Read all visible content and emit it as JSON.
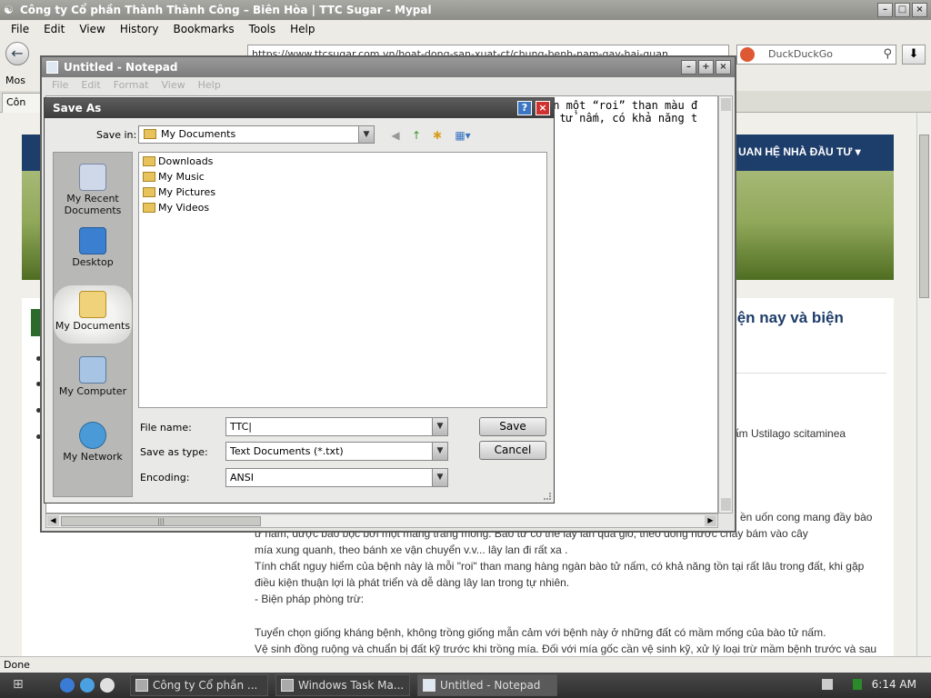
{
  "browser": {
    "title": "Công ty Cổ phần Thành Thành Công – Biên Hòa | TTC Sugar - Mypal",
    "menu": [
      "File",
      "Edit",
      "View",
      "History",
      "Bookmarks",
      "Tools",
      "Help"
    ],
    "site_identity": "ttcsugar.com.vn",
    "url": "https://www.ttcsugar.com.vn/hoat-dong-san-xuat-ct/chung-benh-nam-gay-hai-quan",
    "search_placeholder": "DuckDuckGo",
    "bookmarks_label": "Mos",
    "tab_label": "Côn",
    "status": "Done"
  },
  "page": {
    "nav_label": "UAN HỆ NHÀ ĐẦU TƯ ▾",
    "heading": "iện nay và biện",
    "side_line": "ấm Ustilago scitaminea",
    "text_lines": [
      "ền uốn cong mang đầy bào",
      "ư nấm, được bao bọc bởi một màng trắng mỏng. Bào tử có thể lây lan qua gió, theo dòng nước chảy bám vào cây",
      "mía xung quanh, theo bánh xe vận chuyển v.v... lây lan đi rất xa .",
      "Tính chất nguy hiểm của bệnh này là mỗi \"roi\" than mang hàng ngàn bào tử nấm, có khả năng tồn tại rất lâu trong đất, khi gặp",
      "điều kiện thuận lợi là phát triển và dễ dàng lây lan trong tự nhiên.",
      "- Biện pháp phòng trừ:",
      "  Tuyển chọn giống kháng bệnh, không trồng giống mẫn cảm với bệnh này ở những đất có mầm mống của bào tử nấm.",
      "Vệ sinh đồng ruộng và chuẩn bị đất kỹ trước khi trồng mía. Đối với mía gốc cần vệ sinh kỹ, xử lý loại trừ mầm bệnh trước và sau"
    ]
  },
  "notepad": {
    "title": "Untitled - Notepad",
    "menu": [
      "File",
      "Edit",
      "Format",
      "View",
      "Help"
    ],
    "text_line1": "ên một “roi” than màu đ",
    "text_line2": "o tử nấm, có khả năng t"
  },
  "saveas": {
    "title": "Save As",
    "save_in_label": "Save in:",
    "save_in_value": "My Documents",
    "places": [
      "My Recent Documents",
      "Desktop",
      "My Documents",
      "My Computer",
      "My Network"
    ],
    "files": [
      "Downloads",
      "My Music",
      "My Pictures",
      "My Videos"
    ],
    "file_name_label": "File name:",
    "file_name_value": "TTC|",
    "save_type_label": "Save as type:",
    "save_type_value": "Text Documents (*.txt)",
    "encoding_label": "Encoding:",
    "encoding_value": "ANSI",
    "save_button": "Save",
    "cancel_button": "Cancel"
  },
  "taskbar": {
    "tasks": [
      "Công ty Cổ phần ...",
      "Windows Task Ma...",
      "Untitled - Notepad"
    ],
    "clock": "6:14 AM"
  },
  "colors": {
    "page_nav": "#1d3d6a",
    "dialog_title": "#4a4a4a",
    "taskbar": "#333333"
  }
}
